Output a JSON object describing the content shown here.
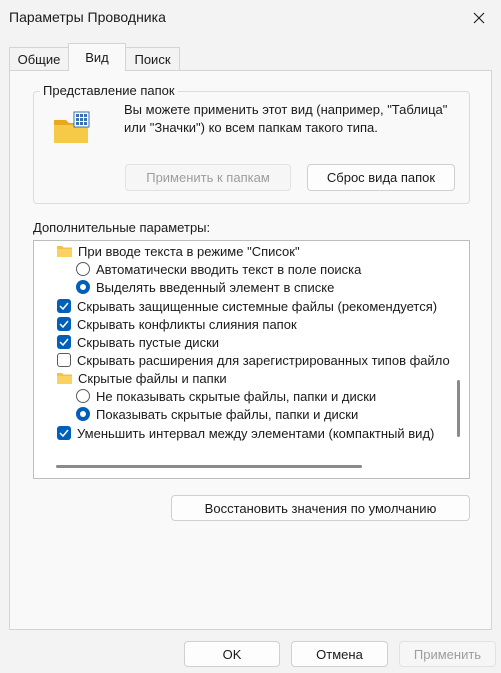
{
  "window": {
    "title": "Параметры Проводника"
  },
  "tabs": [
    {
      "label": "Общие"
    },
    {
      "label": "Вид"
    },
    {
      "label": "Поиск"
    }
  ],
  "folder_views": {
    "legend": "Представление папок",
    "description": "Вы можете применить этот вид (например, \"Таблица\" или \"Значки\") ко всем папкам такого типа.",
    "apply_button": "Применить к папкам",
    "reset_button": "Сброс вида папок"
  },
  "advanced": {
    "label": "Дополнительные параметры:",
    "items": [
      {
        "type": "folder",
        "label": "При вводе текста в режиме \"Список\""
      },
      {
        "type": "radio",
        "checked": false,
        "label": "Автоматически вводить текст в поле поиска"
      },
      {
        "type": "radio",
        "checked": true,
        "label": "Выделять введенный элемент в списке"
      },
      {
        "type": "checkbox",
        "checked": true,
        "label": "Скрывать защищенные системные файлы (рекомендуется)"
      },
      {
        "type": "checkbox",
        "checked": true,
        "label": "Скрывать конфликты слияния папок"
      },
      {
        "type": "checkbox",
        "checked": true,
        "label": "Скрывать пустые диски"
      },
      {
        "type": "checkbox",
        "checked": false,
        "label": "Скрывать расширения для зарегистрированных типов файлов"
      },
      {
        "type": "folder",
        "label": "Скрытые файлы и папки"
      },
      {
        "type": "radio",
        "checked": false,
        "label": "Не показывать скрытые файлы, папки и диски"
      },
      {
        "type": "radio",
        "checked": true,
        "label": "Показывать скрытые файлы, папки и диски"
      },
      {
        "type": "checkbox",
        "checked": true,
        "label": "Уменьшить интервал между элементами (компактный вид)"
      }
    ]
  },
  "restore_button": "Восстановить значения по умолчанию",
  "dialog_buttons": {
    "ok": "OK",
    "cancel": "Отмена",
    "apply": "Применить"
  },
  "colors": {
    "accent": "#005fb8",
    "folder": "#f4c04a"
  }
}
